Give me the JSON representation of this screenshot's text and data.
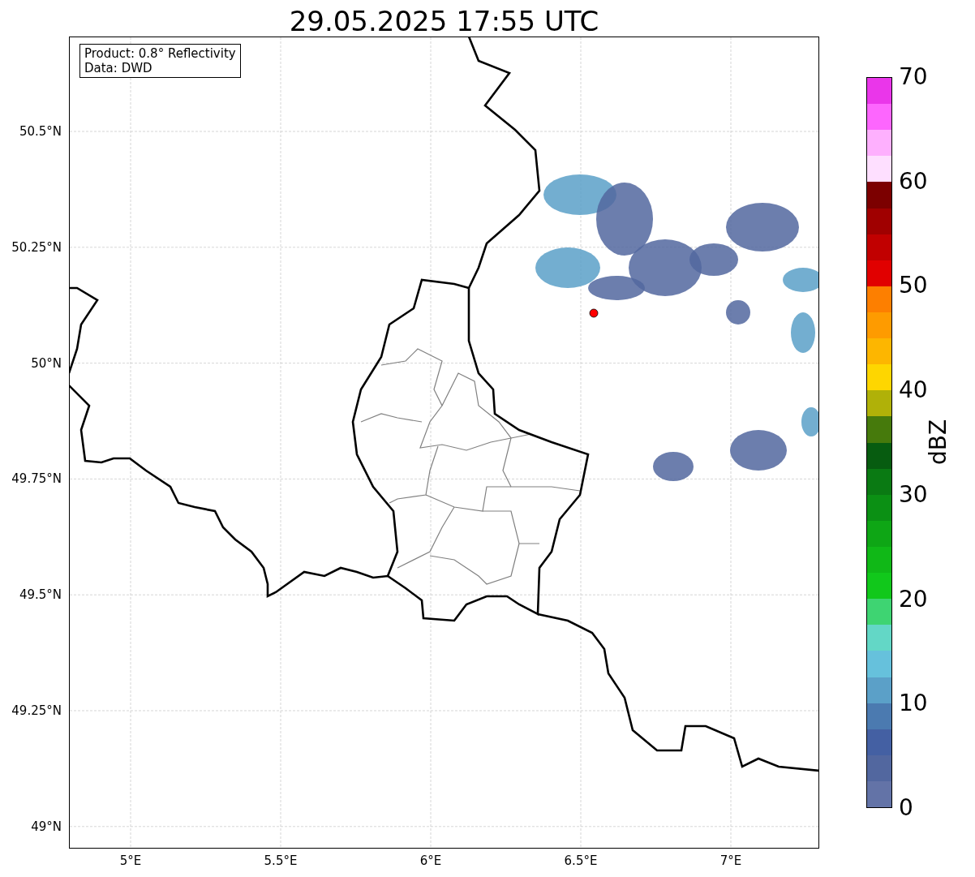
{
  "title": "29.05.2025 17:55 UTC",
  "info_box": [
    "Product: 0.8° Reflectivity",
    "Data: DWD"
  ],
  "map": {
    "lat_labels": [
      "50.5°N",
      "50.25°N",
      "50°N",
      "49.75°N",
      "49.5°N",
      "49.25°N",
      "49°N"
    ],
    "lon_labels": [
      "5°E",
      "5.5°E",
      "6°E",
      "6.5°E",
      "7°E"
    ]
  },
  "colorbar": {
    "label": "dBZ",
    "ticks": [
      "70",
      "60",
      "50",
      "40",
      "30",
      "20",
      "10",
      "0"
    ],
    "bands": [
      {
        "color": "#ea36ea"
      },
      {
        "color": "#fd66fe"
      },
      {
        "color": "#feb0fe"
      },
      {
        "color": "#fedfff"
      },
      {
        "color": "#7c0000"
      },
      {
        "color": "#a00000"
      },
      {
        "color": "#c10000"
      },
      {
        "color": "#e10000"
      },
      {
        "color": "#fd7f00"
      },
      {
        "color": "#fe9b00"
      },
      {
        "color": "#fdb600"
      },
      {
        "color": "#fed600"
      },
      {
        "color": "#b0b108"
      },
      {
        "color": "#467a0c"
      },
      {
        "color": "#075c10"
      },
      {
        "color": "#0a7a13"
      },
      {
        "color": "#0b9014"
      },
      {
        "color": "#0ea615"
      },
      {
        "color": "#10b817"
      },
      {
        "color": "#11c81b"
      },
      {
        "color": "#3ed472"
      },
      {
        "color": "#63d7c6"
      },
      {
        "color": "#66c1dc"
      },
      {
        "color": "#5ba0c8"
      },
      {
        "color": "#4b7ab0"
      },
      {
        "color": "#4460a3"
      },
      {
        "color": "#52679f"
      },
      {
        "color": "#6373a7"
      }
    ]
  }
}
